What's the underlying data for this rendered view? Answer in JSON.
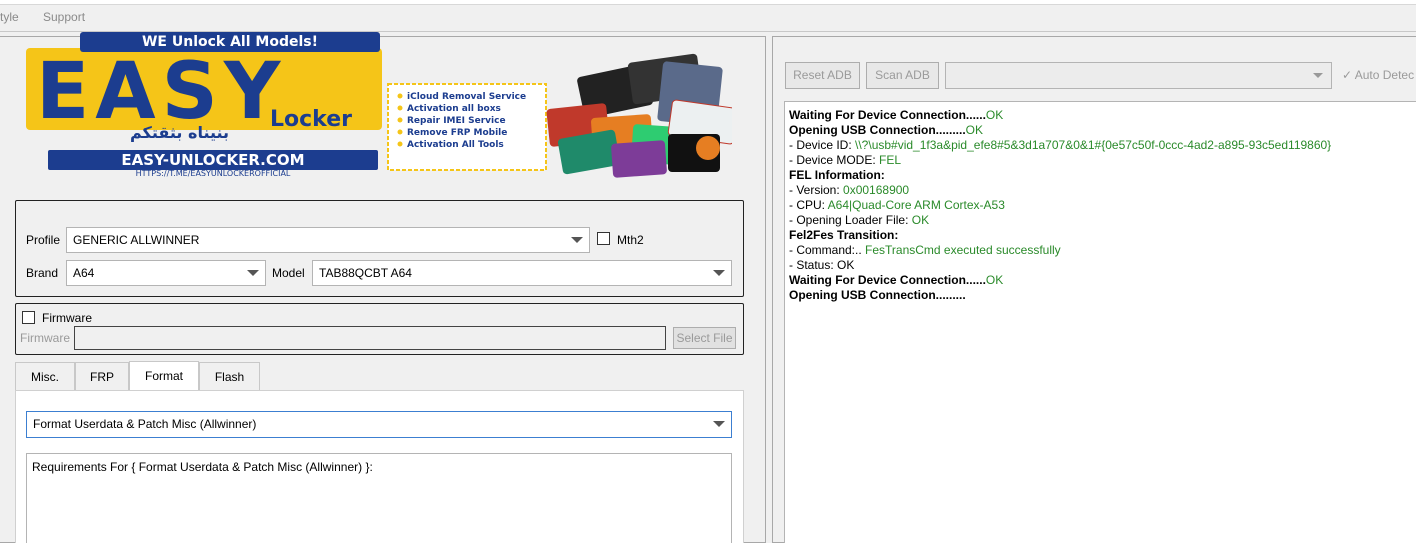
{
  "menu": {
    "style": "tyle",
    "support": "Support"
  },
  "logo": {
    "banner": "WE Unlock All Models!",
    "brand": "EASY",
    "sub": "Locker",
    "arabic": "بنيناه بثقتكم",
    "site": "EASY-UNLOCKER.COM",
    "link": "HTTPS://T.ME/EASYUNLOCKEROFFICIAL",
    "services": [
      "iCloud Removal Service",
      "Activation all boxs",
      "Repair IMEI Service",
      "Remove FRP Mobile",
      "Activation All Tools"
    ]
  },
  "profile": {
    "profile_label": "Profile",
    "profile_value": "GENERIC ALLWINNER",
    "mth2_label": "Mth2",
    "brand_label": "Brand",
    "brand_value": "A64",
    "model_label": "Model",
    "model_value": "TAB88QCBT A64"
  },
  "firmware": {
    "checkbox_label": "Firmware",
    "field_label": "Firmware",
    "select_button": "Select File"
  },
  "tabs": [
    {
      "label": "Misc."
    },
    {
      "label": "FRP"
    },
    {
      "label": "Format"
    },
    {
      "label": "Flash"
    }
  ],
  "format": {
    "operation": "Format Userdata & Patch Misc (Allwinner)",
    "requirements": "Requirements For { Format Userdata & Patch Misc (Allwinner) }:"
  },
  "adb": {
    "reset": "Reset ADB",
    "scan": "Scan ADB",
    "device": "",
    "auto_detect": "✓  Auto Detec"
  },
  "log": [
    {
      "k": "Waiting For Device Connection......",
      "v": "OK",
      "bold": true
    },
    {
      "k": "Opening USB Connection.........",
      "v": "OK",
      "bold": true
    },
    {
      "k": "- Device ID: ",
      "v": "\\\\?\\usb#vid_1f3a&pid_efe8#5&3d1a707&0&1#{0e57c50f-0ccc-4ad2-a895-93c5ed119860}",
      "bold": false
    },
    {
      "k": "- Device MODE: ",
      "v": "FEL",
      "bold": false
    },
    {
      "k": "FEL Information:",
      "v": "",
      "bold": true
    },
    {
      "k": "- Version: ",
      "v": "0x00168900",
      "bold": false
    },
    {
      "k": "- CPU: ",
      "v": "A64|Quad-Core ARM Cortex-A53",
      "bold": false
    },
    {
      "k": "- Opening Loader File: ",
      "v": "OK",
      "bold": false
    },
    {
      "k": "Fel2Fes Transition:",
      "v": "",
      "bold": true
    },
    {
      "k": "- Command:.. ",
      "v": "FesTransCmd executed successfully",
      "bold": false
    },
    {
      "k": "- Status: OK",
      "v": "",
      "bold": false
    },
    {
      "k": "Waiting For Device Connection......",
      "v": "OK",
      "bold": true
    },
    {
      "k": "Opening USB Connection.........",
      "v": "",
      "bold": true
    }
  ],
  "colors": {
    "log_ok": "#2a8a2a",
    "logo_yellow": "#f5c518",
    "logo_blue": "#1c3d8f"
  }
}
